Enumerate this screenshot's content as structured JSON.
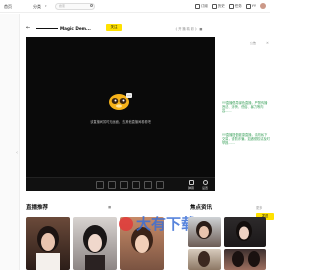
{
  "top_bar": {
    "home": "首页",
    "category": "分类",
    "search_placeholder": "搜索",
    "icons": [
      {
        "name": "subscribe",
        "label": "订阅",
        "icon": "subscribe-icon"
      },
      {
        "name": "history",
        "label": "历史",
        "icon": "history-icon"
      },
      {
        "name": "task",
        "label": "任务",
        "icon": "task-icon"
      },
      {
        "name": "pay",
        "label": "YY",
        "icon": "yy-icon"
      }
    ]
  },
  "sidebar": {
    "items": [
      "",
      "",
      "",
      "",
      "",
      "",
      "",
      "",
      ""
    ]
  },
  "room": {
    "title": "Magic Dem...",
    "follow_label": "关注",
    "more_link": "《 开 播 精 彩 》 ■"
  },
  "player": {
    "message": "该直播间暂时无画面，去其他直播间看看吧"
  },
  "controls": {
    "right_items": [
      {
        "label": "弹幕",
        "icon": "danmaku-icon"
      },
      {
        "label": "设置",
        "icon": "settings-icon"
      }
    ]
  },
  "chat": {
    "header": "公告",
    "messages": [
      "YY直播倡导绿色直播，严禁传播违法、涉黄、低俗、暴力等内容……",
      "YY直播提倡健康直播，请勿私下交易，谨防诈骗，如遇侵权请及时举报……"
    ],
    "send_label": "发送"
  },
  "sections": {
    "live": "直播推荐",
    "live_more": "■",
    "news": "焦点资讯",
    "news_more": "更多"
  },
  "colors": {
    "accent": "#ffe100",
    "chat_green": "#3aa05a",
    "player_bg": "#0a0a0a"
  }
}
